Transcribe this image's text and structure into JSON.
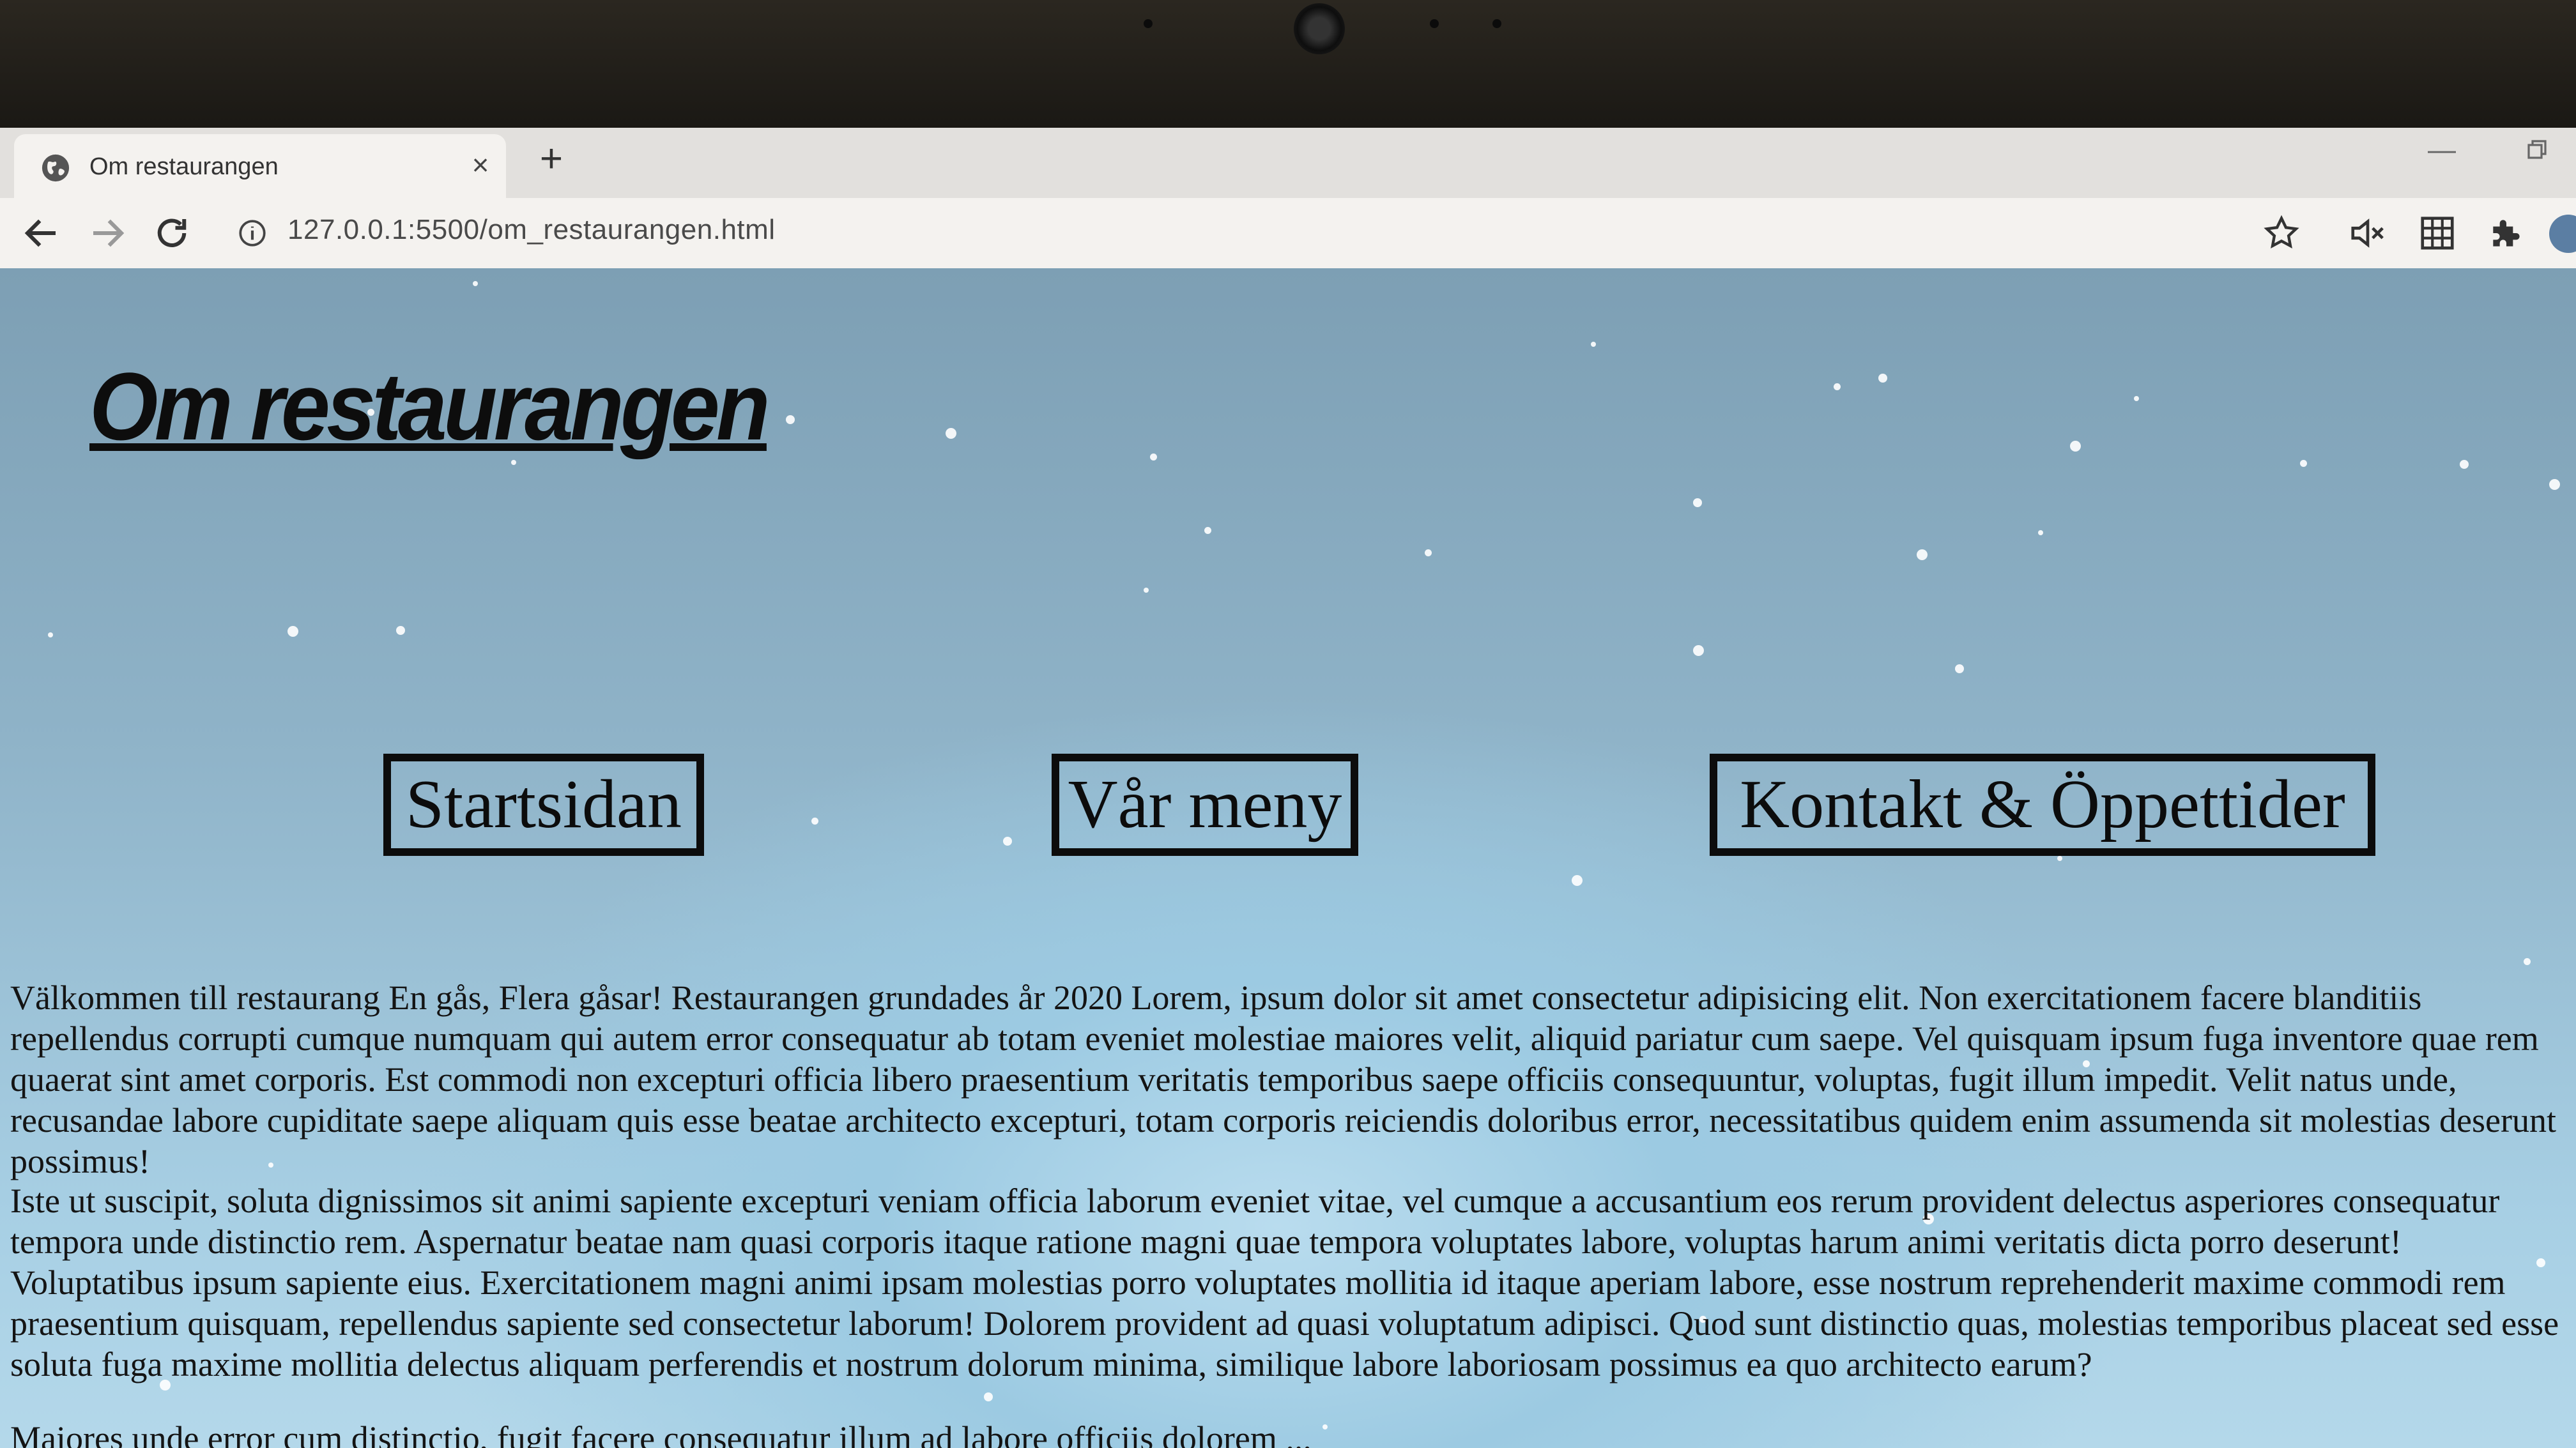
{
  "browser": {
    "tab_title": "Om restaurangen",
    "tab_close_icon": "close-icon",
    "new_tab_icon": "plus-icon",
    "url": "127.0.0.1:5500/om_restaurangen.html",
    "icons": [
      "back-arrow-icon",
      "forward-arrow-icon",
      "reload-icon",
      "info-icon",
      "bookmark-star-icon",
      "muted-speaker-icon",
      "grid-icon",
      "extensions-puzzle-icon"
    ]
  },
  "page": {
    "title": "Om restaurangen",
    "nav": {
      "home": "Startsidan",
      "menu": "Vår meny",
      "contact": "Kontakt & Öppettider"
    },
    "paragraphs": [
      "Välkommen till restaurang En gås, Flera gåsar! Restaurangen grundades år 2020 Lorem, ipsum dolor sit amet consectetur adipisicing elit. Non exercitationem facere blanditiis repellendus corrupti cumque numquam qui autem error consequatur ab totam eveniet molestiae maiores velit, aliquid pariatur cum saepe. Vel quisquam ipsum fuga inventore quae rem quaerat sint amet corporis. Est commodi non excepturi officia libero praesentium veritatis temporibus saepe officiis consequuntur, voluptas, fugit illum impedit. Velit natus unde, recusandae labore cupiditate saepe aliquam quis esse beatae architecto excepturi, totam corporis reiciendis doloribus error, necessitatibus quidem enim assumenda sit molestias deserunt possimus!",
      "Iste ut suscipit, soluta dignissimos sit animi sapiente excepturi veniam officia laborum eveniet vitae, vel cumque a accusantium eos rerum provident delectus asperiores consequatur tempora unde distinctio rem. Aspernatur beatae nam quasi corporis itaque ratione magni quae tempora voluptates labore, voluptas harum animi veritatis dicta porro deserunt! Voluptatibus ipsum sapiente eius. Exercitationem magni animi ipsam molestias porro voluptates mollitia id itaque aperiam labore, esse nostrum reprehenderit maxime commodi rem praesentium quisquam, repellendus sapiente sed consectetur laborum! Dolorem provident ad quasi voluptatum adipisci. Quod sunt distinctio quas, molestias temporibus placeat sed esse soluta fuga maxime mollitia delectus aliquam perferendis et nostrum dolorum minima, similique labore laboriosam possimus ea quo architecto earum?",
      "Maiores unde error cum distinctio, fugit facere consequatur illum ad labore officiis dolorem ..."
    ]
  },
  "colors": {
    "text": "#0c0c0c",
    "background_top": "#7d9fb4",
    "background_bottom": "#b4d8ea"
  }
}
